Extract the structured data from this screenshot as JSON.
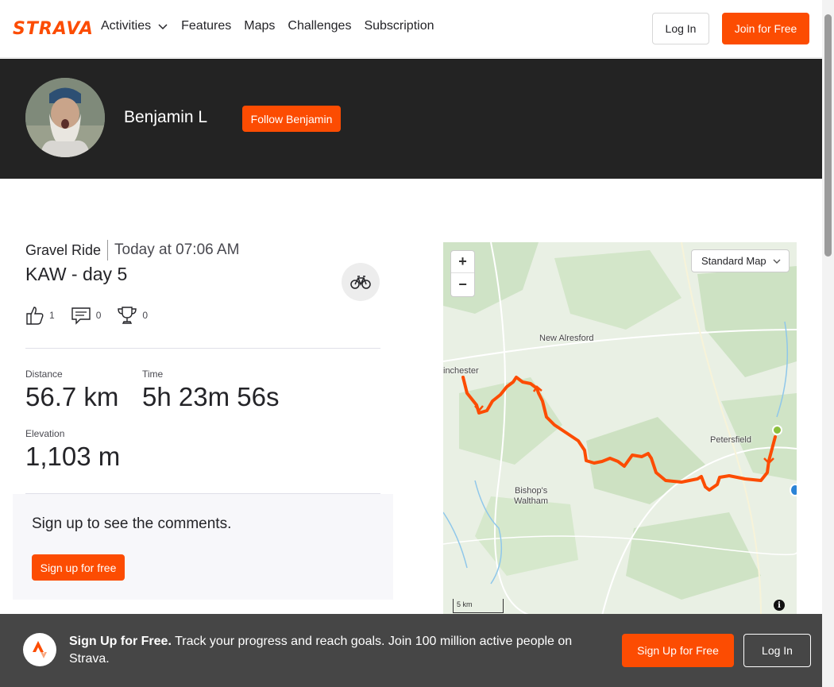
{
  "brand": {
    "logo_text": "STRAVA",
    "accent": "#fc4c02"
  },
  "nav": {
    "items": [
      {
        "label": "Activities",
        "has_dropdown": true
      },
      {
        "label": "Features"
      },
      {
        "label": "Maps"
      },
      {
        "label": "Challenges"
      },
      {
        "label": "Subscription"
      }
    ],
    "login_label": "Log In",
    "join_label": "Join for Free"
  },
  "athlete": {
    "name": "Benjamin L",
    "follow_label": "Follow Benjamin"
  },
  "activity": {
    "type": "Gravel Ride",
    "when": "Today at 07:06 AM",
    "title": "KAW - day 5",
    "sport_icon": "bike-icon",
    "kudos": "1",
    "comments": "0",
    "achievements": "0",
    "stats": {
      "distance_label": "Distance",
      "distance_value": "56.7 km",
      "time_label": "Time",
      "time_value": "5h 23m 56s",
      "elevation_label": "Elevation",
      "elevation_value": "1,103 m"
    }
  },
  "comments_section": {
    "prompt": "Sign up to see the comments.",
    "button_label": "Sign up for free"
  },
  "map": {
    "style_label": "Standard Map",
    "zoom_in": "+",
    "zoom_out": "−",
    "scale_label": "5 km",
    "info": "i",
    "places": {
      "new_alresford": "New Alresford",
      "winchester": "inchester",
      "petersfield": "Petersfield",
      "bishops_waltham_1": "Bishop's",
      "bishops_waltham_2": "Waltham"
    },
    "route_color": "#fc4c02"
  },
  "banner": {
    "headline": "Sign Up for Free.",
    "text": " Track your progress and reach goals. Join 100 million active people on Strava.",
    "signup_label": "Sign Up for Free",
    "login_label": "Log In"
  }
}
